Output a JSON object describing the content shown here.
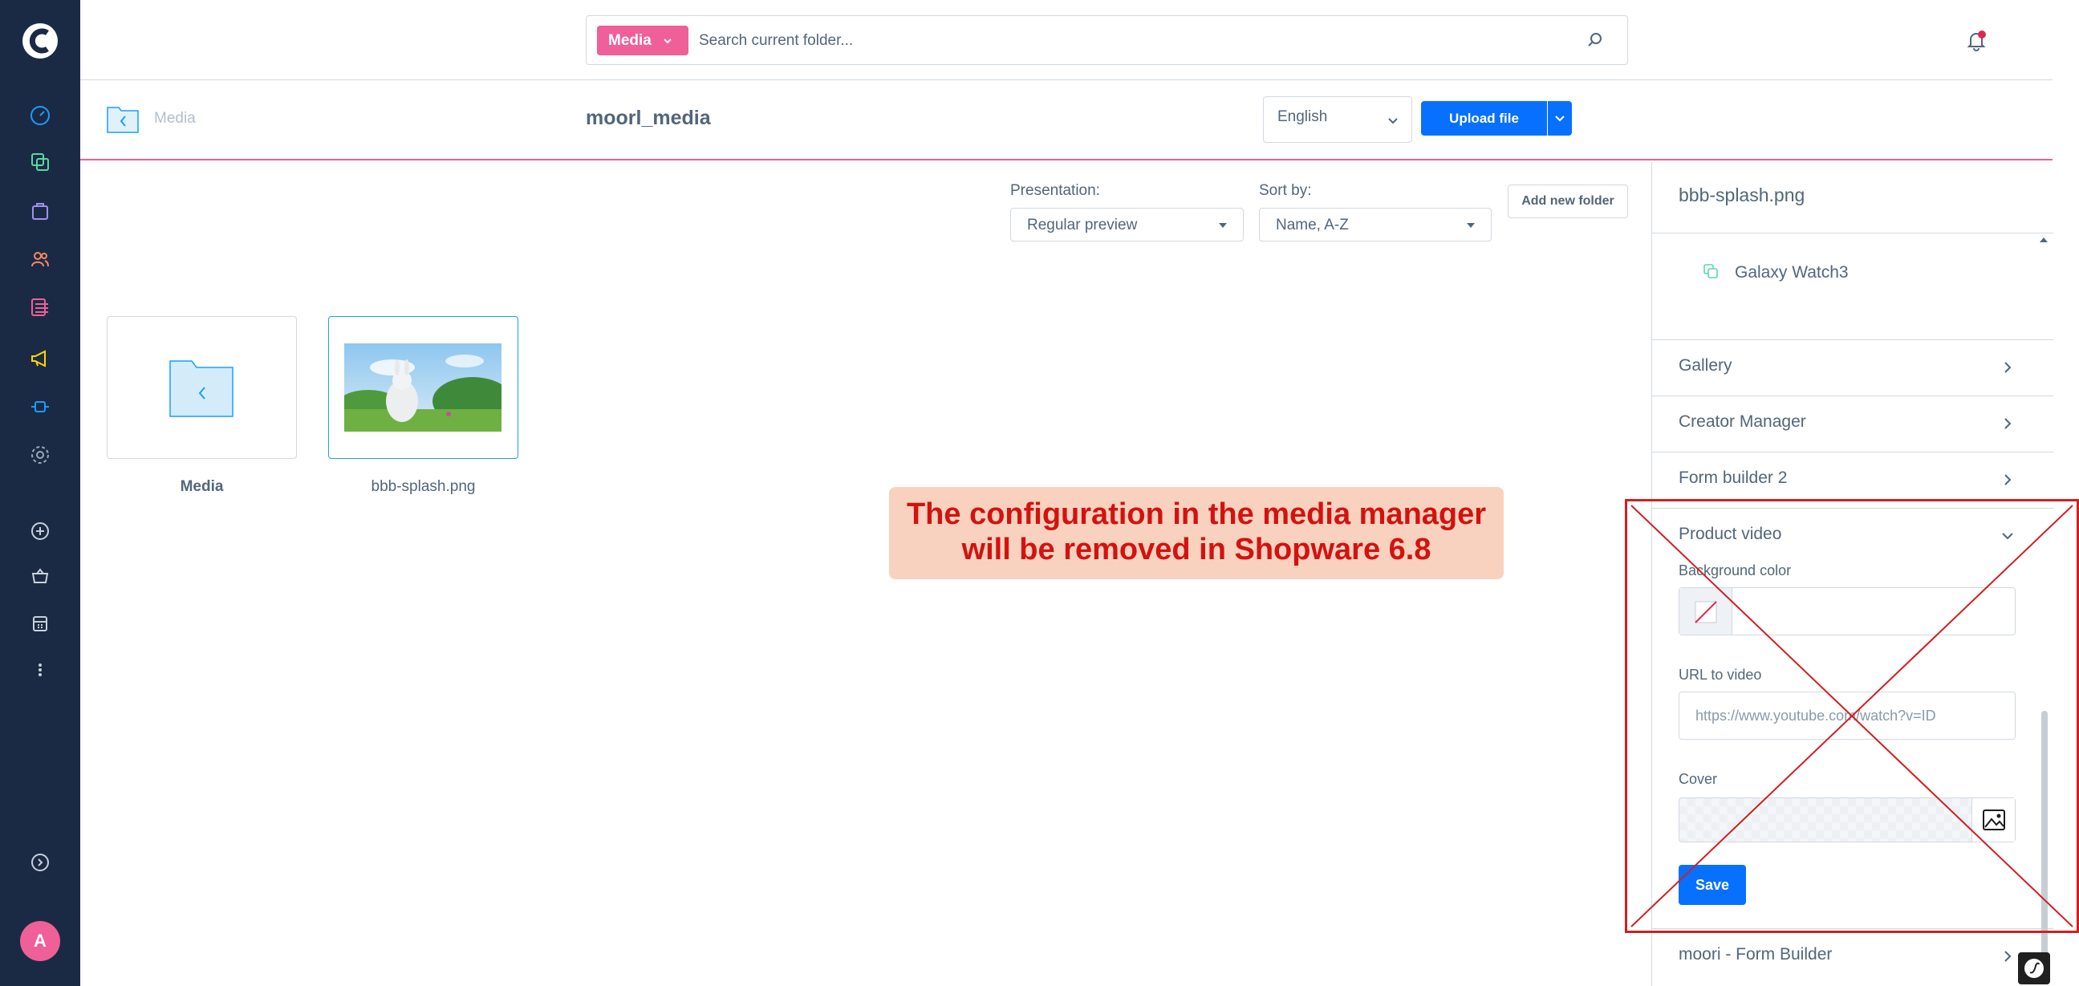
{
  "app": {
    "avatar_initial": "A"
  },
  "nav": {
    "icons": [
      "logo",
      "dashboard-icon",
      "catalogues-icon",
      "orders-icon",
      "customers-icon",
      "content-icon",
      "marketing-icon",
      "extensions-icon",
      "settings-icon",
      "add-icon",
      "basket-icon",
      "store-icon",
      "more-icon",
      "expand-icon"
    ],
    "colors": {
      "bg": "#1b2a44",
      "catalogues": "#57d9a3",
      "orders": "#a092f0",
      "customers": "#f88962",
      "content": "#ef5f98",
      "marketing": "#ffd700",
      "extensions": "#189eff",
      "settings": "#9aa8b5"
    }
  },
  "search": {
    "pill_label": "Media",
    "placeholder": "Search current folder..."
  },
  "header": {
    "breadcrumb": "Media",
    "title": "moorl_media",
    "language": "English",
    "upload_label": "Upload file"
  },
  "toolbar": {
    "presentation_label": "Presentation:",
    "presentation_value": "Regular preview",
    "sort_label": "Sort by:",
    "sort_value": "Name, A-Z",
    "add_folder_label": "Add new folder"
  },
  "items": [
    {
      "label": "Media",
      "type": "folder-back"
    },
    {
      "label": "bbb-splash.png",
      "type": "image"
    }
  ],
  "notice": {
    "line1": "The configuration in the media manager",
    "line2": "will be removed in Shopware 6.8",
    "bg_color": "#f8d2bf",
    "text_color": "#d3120f"
  },
  "sidebar": {
    "title": "bbb-splash.png",
    "product": "Galaxy Watch3",
    "accordions": [
      "Gallery",
      "Creator Manager",
      "Form builder 2"
    ],
    "open_section": "Product video",
    "bg_color_label": "Background color",
    "url_label": "URL to video",
    "url_placeholder": "https://www.youtube.com/watch?v=ID",
    "cover_label": "Cover",
    "save_label": "Save",
    "last_accordion": "moori - Form Builder"
  },
  "colors": {
    "accent": "#0870ff",
    "media_pink": "#ef5f98",
    "cross_red": "#d11f1f",
    "selection_blue": "#189eff"
  }
}
